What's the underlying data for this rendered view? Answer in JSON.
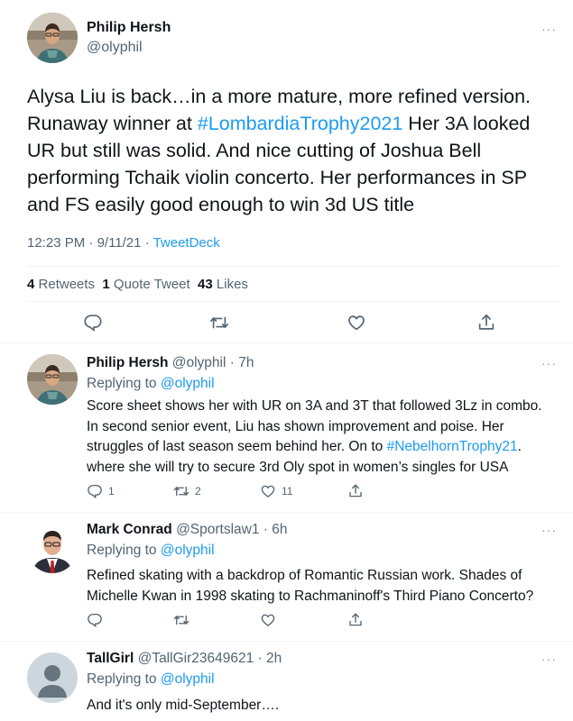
{
  "main_tweet": {
    "author_name": "Philip Hersh",
    "author_handle": "@olyphil",
    "text_before": "Alysa Liu is back…in a more mature, more refined version. Runaway winner at ",
    "hashtag": "#LombardiaTrophy2021",
    "text_after": " Her 3A looked UR but still was solid.  And nice cutting of Joshua Bell performing Tchaik violin concerto.  Her performances in SP and FS easily good enough to win 3d US title",
    "time": "12:23 PM",
    "date": "9/11/21",
    "source": "TweetDeck",
    "retweets": "4",
    "retweets_label": "Retweets",
    "quotes": "1",
    "quotes_label": "Quote Tweet",
    "likes": "43",
    "likes_label": "Likes",
    "more": "···"
  },
  "replies": [
    {
      "name": "Philip Hersh",
      "handle": "@olyphil",
      "age": "7h",
      "replying_label": "Replying to",
      "replying_to": "@olyphil",
      "text_before": "Score sheet shows her with UR on 3A and 3T that followed 3Lz in combo. In second senior event, Liu has shown improvement and poise.  Her struggles of last season seem behind her.  On to ",
      "hashtag": "#NebelhornTrophy21",
      "text_after": ". where she will try to secure 3rd Oly spot in women’s singles for USA",
      "reply_count": "1",
      "retweet_count": "2",
      "like_count": "11",
      "more": "···"
    },
    {
      "name": "Mark Conrad",
      "handle": "@Sportslaw1",
      "age": "6h",
      "replying_label": "Replying to",
      "replying_to": "@olyphil",
      "text": "Refined skating with a backdrop of Romantic Russian work. Shades of Michelle Kwan in 1998 skating to Rachmaninoff's Third Piano Concerto?",
      "more": "···"
    },
    {
      "name": "TallGirl",
      "handle": "@TallGir23649621",
      "age": "2h",
      "replying_label": "Replying to",
      "replying_to": "@olyphil",
      "text": "And it's only mid-September….",
      "more": "···"
    }
  ],
  "icons": {
    "reply": "reply-icon",
    "retweet": "retweet-icon",
    "like": "heart-icon",
    "share": "share-icon"
  },
  "colors": {
    "link": "#1d9bf0",
    "secondary_text": "#536471",
    "divider": "#eff3f4"
  }
}
